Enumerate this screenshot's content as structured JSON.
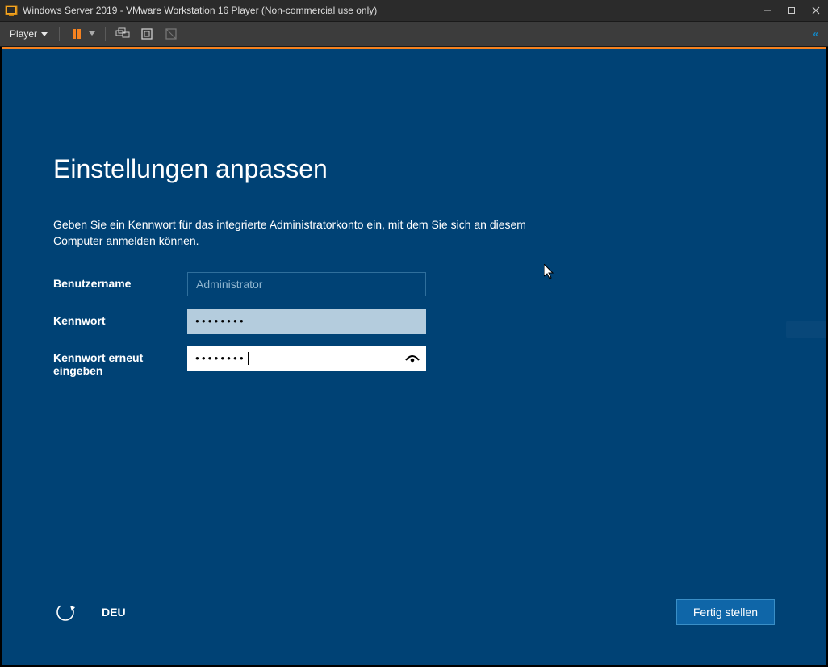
{
  "window": {
    "title": "Windows Server 2019 - VMware Workstation 16 Player (Non-commercial use only)"
  },
  "menu": {
    "player_label": "Player"
  },
  "oobe": {
    "heading": "Einstellungen anpassen",
    "description": "Geben Sie ein Kennwort für das integrierte Administratorkonto ein, mit dem Sie sich an diesem Computer anmelden können.",
    "fields": {
      "username_label": "Benutzername",
      "username_value": "Administrator",
      "password_label": "Kennwort",
      "password_masked": "●●●●●●●●",
      "password_confirm_label": "Kennwort erneut eingeben",
      "password_confirm_masked": "●●●●●●●●"
    },
    "language_indicator": "DEU",
    "finish_label": "Fertig stellen"
  }
}
